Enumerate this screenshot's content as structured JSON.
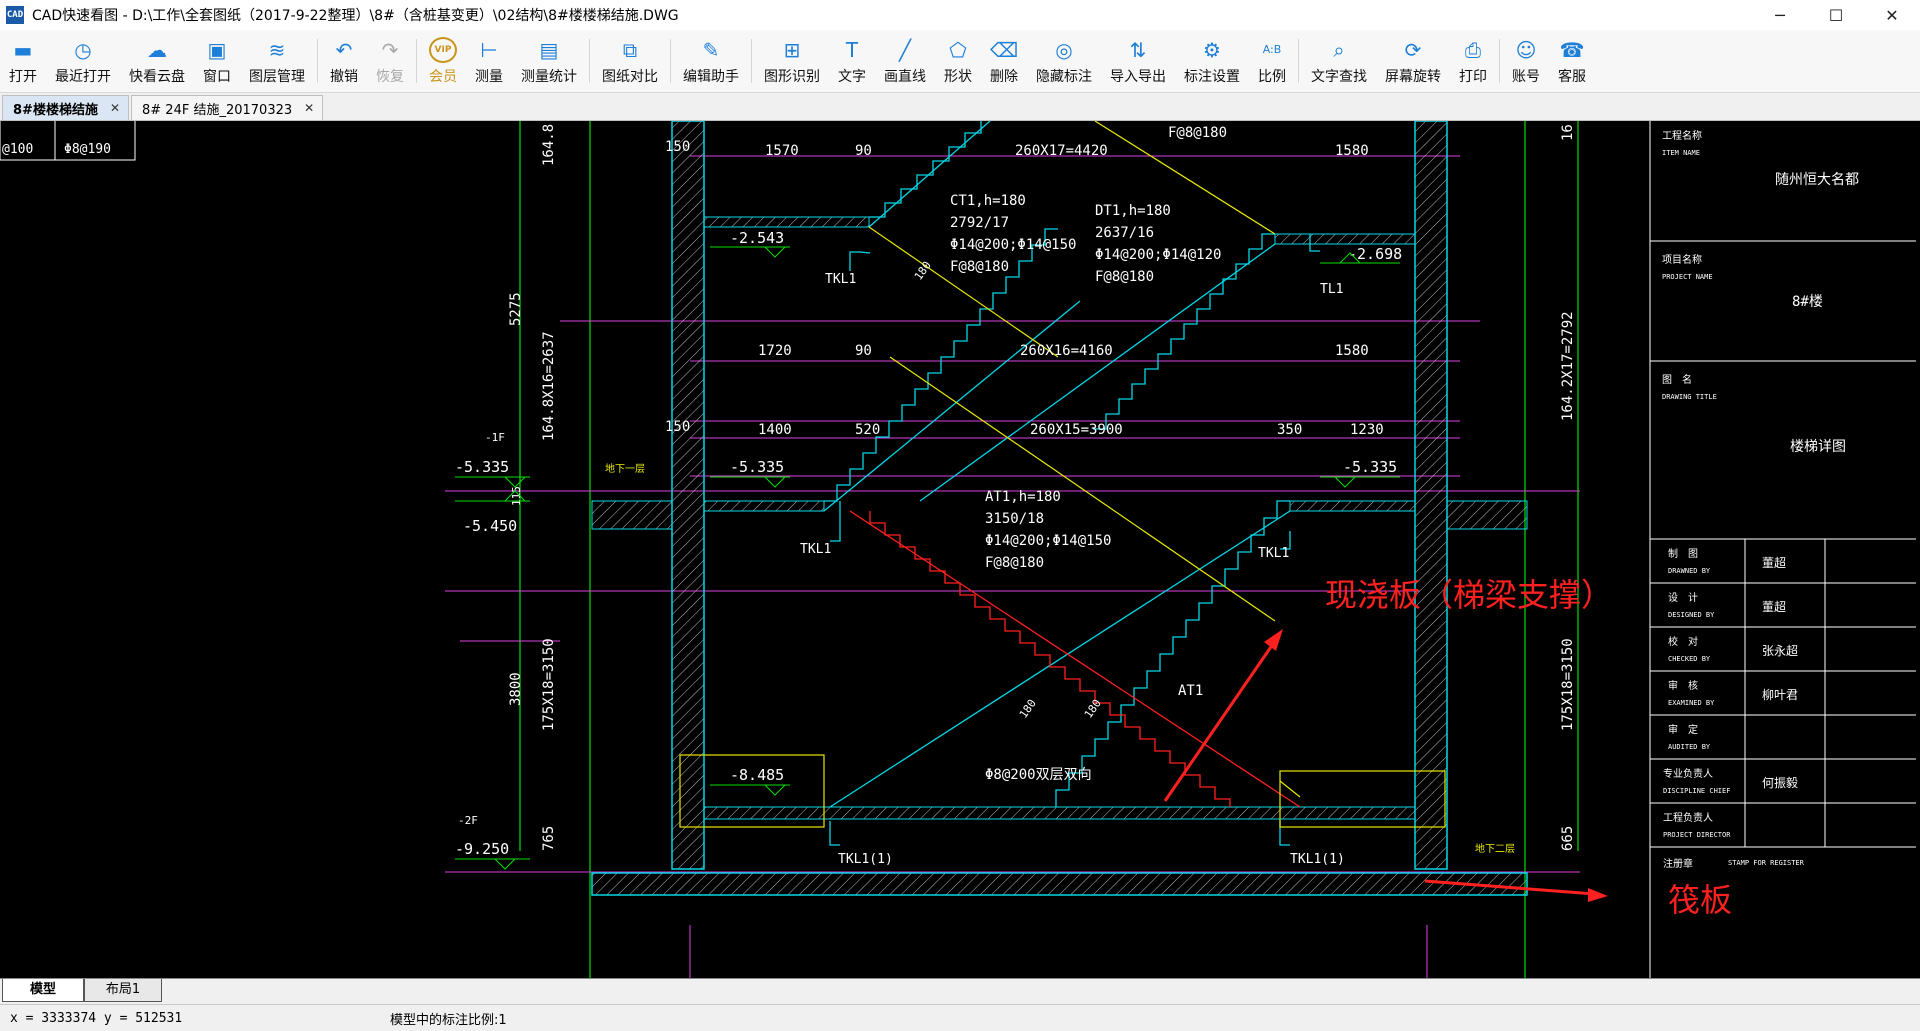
{
  "window": {
    "app_icon": "CAD",
    "title": "CAD快速看图 - D:\\工作\\全套图纸（2017-9-22整理）\\8#（含桩基变更）\\02结构\\8#楼楼梯结施.DWG",
    "controls": {
      "minimize": "─",
      "maximize": "☐",
      "close": "✕"
    }
  },
  "toolbar": {
    "items": [
      {
        "label": "打开",
        "icon": "folder-open-icon",
        "glyph": "▬"
      },
      {
        "label": "最近打开",
        "icon": "clock-icon",
        "glyph": "◷"
      },
      {
        "label": "快看云盘",
        "icon": "cloud-icon",
        "glyph": "☁"
      },
      {
        "label": "窗口",
        "icon": "window-icon",
        "glyph": "▣"
      },
      {
        "label": "图层管理",
        "icon": "layers-icon",
        "glyph": "≋"
      },
      {
        "label": "撤销",
        "icon": "undo-icon",
        "glyph": "↶"
      },
      {
        "label": "恢复",
        "icon": "redo-icon",
        "glyph": "↷"
      },
      {
        "label": "会员",
        "icon": "vip-icon",
        "glyph": "VIP"
      },
      {
        "label": "测量",
        "icon": "ruler-icon",
        "glyph": "⊢"
      },
      {
        "label": "测量统计",
        "icon": "measure-stats-icon",
        "glyph": "▤"
      },
      {
        "label": "图纸对比",
        "icon": "compare-icon",
        "glyph": "⧉"
      },
      {
        "label": "编辑助手",
        "icon": "edit-assistant-icon",
        "glyph": "✎"
      },
      {
        "label": "图形识别",
        "icon": "shape-recognize-icon",
        "glyph": "⊞"
      },
      {
        "label": "文字",
        "icon": "text-icon",
        "glyph": "T"
      },
      {
        "label": "画直线",
        "icon": "line-icon",
        "glyph": "╱"
      },
      {
        "label": "形状",
        "icon": "shapes-icon",
        "glyph": "⬠"
      },
      {
        "label": "删除",
        "icon": "eraser-icon",
        "glyph": "⌫"
      },
      {
        "label": "隐藏标注",
        "icon": "hide-eye-icon",
        "glyph": "◎"
      },
      {
        "label": "导入导出",
        "icon": "import-export-icon",
        "glyph": "⇅"
      },
      {
        "label": "标注设置",
        "icon": "annotation-settings-icon",
        "glyph": "⚙"
      },
      {
        "label": "比例",
        "icon": "scale-icon",
        "glyph": "A:B"
      },
      {
        "label": "文字查找",
        "icon": "text-search-icon",
        "glyph": "⌕"
      },
      {
        "label": "屏幕旋转",
        "icon": "rotate-screen-icon",
        "glyph": "⟳"
      },
      {
        "label": "打印",
        "icon": "printer-icon",
        "glyph": "⎙"
      },
      {
        "label": "账号",
        "icon": "user-icon",
        "glyph": "☺"
      },
      {
        "label": "客服",
        "icon": "headset-icon",
        "glyph": "☎"
      }
    ]
  },
  "tabs": [
    {
      "label": "8#楼楼梯结施",
      "close": "✕",
      "active": true
    },
    {
      "label": "8# 24F 结施_20170323",
      "close": "✕",
      "active": false
    }
  ],
  "drawing": {
    "top_left_cells": [
      "@100",
      "Φ8@190"
    ],
    "dims_left": [
      "164.8",
      "5275",
      "164.8X16=2637",
      "115",
      "3800",
      "175X18=3150",
      "765"
    ],
    "dims_right": [
      "16",
      "164.2X17=2792",
      "175X18=3150",
      "665"
    ],
    "row1": [
      "150",
      "1570",
      "90",
      "260X17=4420",
      "1580"
    ],
    "row2": [
      "1720",
      "90",
      "260X16=4160",
      "1580"
    ],
    "row3": [
      "150",
      "1400",
      "520",
      "260X15=3900",
      "350",
      "1230"
    ],
    "levels": [
      "-2.543",
      "-2.698",
      "-1F",
      "-5.335",
      "-5.335",
      "-5.335",
      "-5.450",
      "-8.485",
      "-2F",
      "-9.250"
    ],
    "beams": [
      "TKL1",
      "TL1",
      "TKL1",
      "TKL1",
      "TKL1(1)",
      "TKL1(1)"
    ],
    "ct1": [
      "CT1,h=180",
      "2792/17",
      "Φ14@200;Φ14@150",
      "F@8@180"
    ],
    "dt1": [
      "DT1,h=180",
      "2637/16",
      "Φ14@200;Φ14@120",
      "F@8@180"
    ],
    "at1": [
      "AT1,h=180",
      "3150/18",
      "Φ14@200;Φ14@150",
      "F@8@180"
    ],
    "misc": [
      "F@8@180",
      "180",
      "180",
      "180",
      "AT1",
      "Φ8@200双层双向",
      "地下一层",
      "地下二层"
    ],
    "annotation_board": "现浇板（梯梁支撑）",
    "annotation_raft": "筏板",
    "title_block": {
      "project_label": "工程名称",
      "project_label_en": "ITEM NAME",
      "project_value": "随州恒大名都",
      "item_label": "项目名称",
      "item_label_en": "PROJECT NAME",
      "item_value": "8#楼",
      "drawing_label": "图　名",
      "drawing_label_en": "DRAWING TITLE",
      "drawing_value": "楼梯详图",
      "rows": [
        {
          "cn": "制　图",
          "en": "DRAWNED BY",
          "sig": "董超"
        },
        {
          "cn": "设　计",
          "en": "DESIGNED BY",
          "sig": "董超"
        },
        {
          "cn": "校　对",
          "en": "CHECKED BY",
          "sig": "张永超"
        },
        {
          "cn": "审　核",
          "en": "EXAMINED BY",
          "sig": "柳叶君"
        },
        {
          "cn": "审　定",
          "en": "AUDITED BY",
          "sig": ""
        },
        {
          "cn": "专业负责人",
          "en": "DISCIPLINE CHIEF",
          "sig": "何振毅"
        },
        {
          "cn": "工程负责人",
          "en": "PROJECT DIRECTOR",
          "sig": ""
        }
      ],
      "stamp_cn": "注册章",
      "stamp_en": "STAMP FOR REGISTER"
    }
  },
  "layout_tabs": [
    "模型",
    "布局1"
  ],
  "status": {
    "coords": "x = 3333374  y = 512531",
    "scale": "模型中的标注比例:1"
  },
  "colors": {
    "cyan": "#00d8e8",
    "magenta": "#e040e0",
    "yellow": "#e8e800",
    "red": "#ff2020",
    "green": "#00e000",
    "white": "#ffffff",
    "toolbar_icon": "#1e7fd8"
  }
}
